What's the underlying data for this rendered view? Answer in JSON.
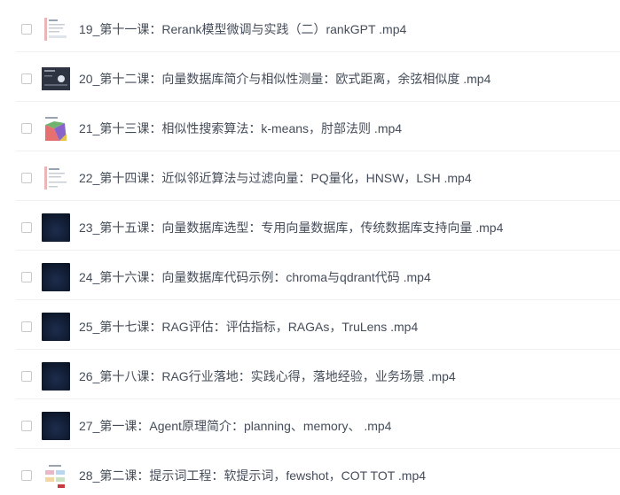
{
  "files": [
    {
      "name": "19_第十一课：Rerank模型微调与实践（二）rankGPT .mp4",
      "thumb": "slide-light-icon"
    },
    {
      "name": "20_第十二课：向量数据库简介与相似性测量：欧式距离，余弦相似度 .mp4",
      "thumb": "slide-dark-video-icon"
    },
    {
      "name": "21_第十三课：相似性搜索算法：k-means，肘部法则 .mp4",
      "thumb": "slide-chart-icon"
    },
    {
      "name": "22_第十四课：近似邻近算法与过滤向量：PQ量化，HNSW，LSH .mp4",
      "thumb": "slide-light-icon"
    },
    {
      "name": "23_第十五课：向量数据库选型：专用向量数据库，传统数据库支持向量 .mp4",
      "thumb": "video-dark-icon"
    },
    {
      "name": "24_第十六课：向量数据库代码示例：chroma与qdrant代码 .mp4",
      "thumb": "video-dark-icon"
    },
    {
      "name": "25_第十七课：RAG评估：评估指标，RAGAs，TruLens .mp4",
      "thumb": "video-dark-icon"
    },
    {
      "name": "26_第十八课：RAG行业落地：实践心得，落地经验，业务场景 .mp4",
      "thumb": "video-dark-icon"
    },
    {
      "name": "27_第一课：Agent原理简介：planning、memory、 .mp4",
      "thumb": "video-dark-icon"
    },
    {
      "name": "28_第二课：提示词工程：软提示词，fewshot，COT TOT .mp4",
      "thumb": "slide-chart-light-icon"
    }
  ],
  "colors": {
    "text": "#454d5a",
    "checkbox_border": "#c9c9c9",
    "divider": "#f0f0f0",
    "dark_thumb": "#0f1b33"
  }
}
